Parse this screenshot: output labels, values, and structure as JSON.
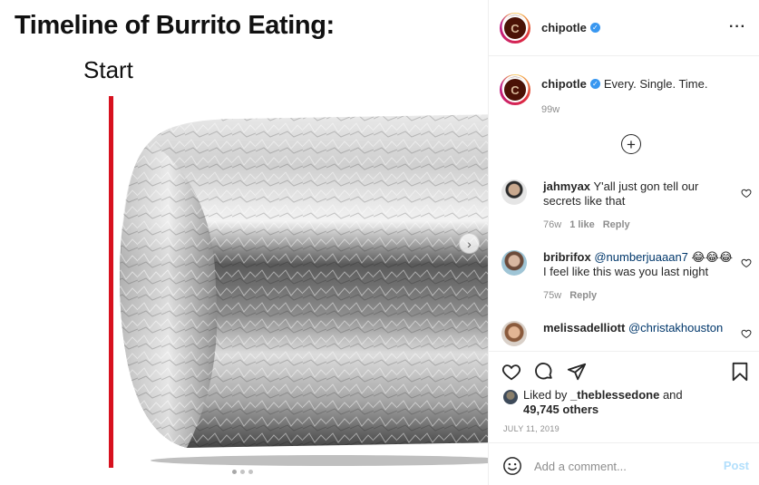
{
  "media": {
    "title": "Timeline of Burrito Eating:",
    "start_label": "Start",
    "carousel_total": 3,
    "carousel_active": 1
  },
  "header": {
    "username": "chipotle",
    "verified": true
  },
  "caption": {
    "username": "chipotle",
    "text": "Every. Single. Time.",
    "time": "99w"
  },
  "comments": [
    {
      "username": "jahmyax",
      "text": "Y'all just gon tell our secrets like that",
      "time": "76w",
      "likes": "1 like",
      "reply": "Reply"
    },
    {
      "username": "bribrifox",
      "mention": "@numberjuaaan7",
      "emoji": "😂😂😂",
      "text": "I feel like this was you last night",
      "time": "75w",
      "reply": "Reply"
    },
    {
      "username": "melissadelliott",
      "mention": "@christakhouston"
    }
  ],
  "likes": {
    "prefix": "Liked by",
    "user": "_theblessedone",
    "joiner": "and",
    "others": "49,745 others"
  },
  "date": "July 11, 2019",
  "add_comment": {
    "placeholder": "Add a comment...",
    "post_label": "Post"
  },
  "colors": {
    "accent_line": "#d7111e",
    "verified": "#3897f0",
    "link": "#00376b",
    "post_disabled": "#b2dffc"
  }
}
